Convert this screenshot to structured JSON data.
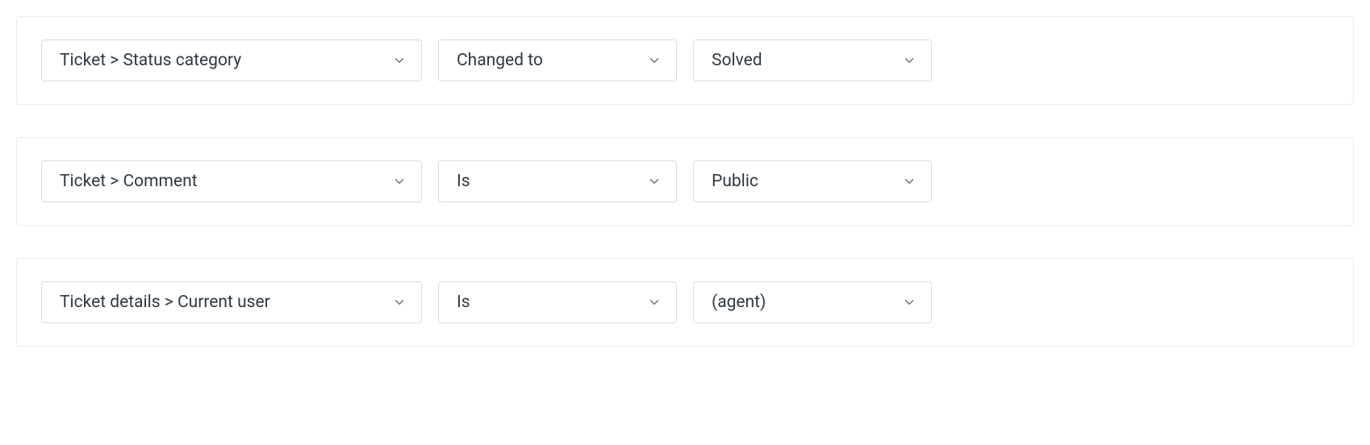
{
  "conditions": [
    {
      "field": "Ticket > Status category",
      "operator": "Changed to",
      "value": "Solved"
    },
    {
      "field": "Ticket > Comment",
      "operator": "Is",
      "value": "Public"
    },
    {
      "field": "Ticket details > Current user",
      "operator": "Is",
      "value": "(agent)"
    }
  ]
}
